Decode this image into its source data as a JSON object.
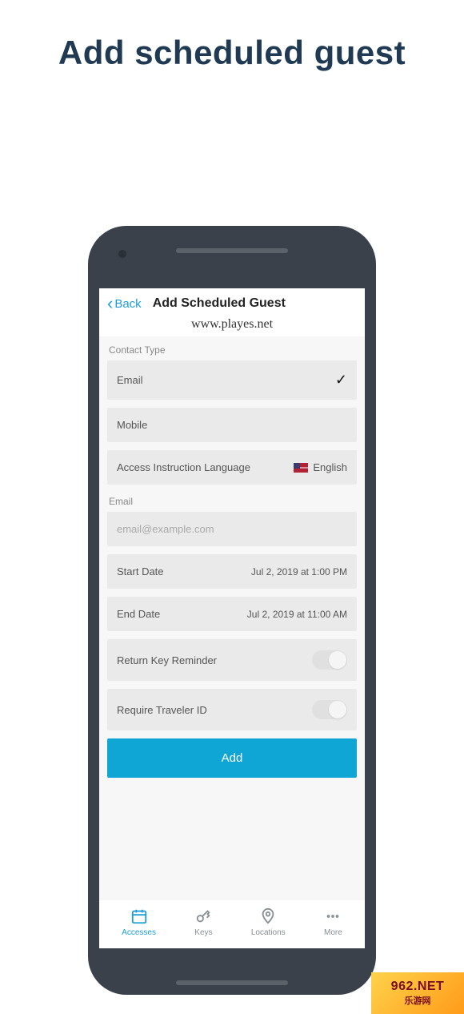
{
  "hero": {
    "title": "Add scheduled guest"
  },
  "watermark": "www.playes.net",
  "nav": {
    "back": "Back",
    "title": "Add Scheduled Guest"
  },
  "form": {
    "contact_type_label": "Contact Type",
    "email_option": "Email",
    "mobile_option": "Mobile",
    "language_label": "Access Instruction Language",
    "language_value": "English",
    "email_section_label": "Email",
    "email_placeholder": "email@example.com",
    "start_date_label": "Start Date",
    "start_date_value": "Jul 2, 2019 at 1:00 PM",
    "end_date_label": "End Date",
    "end_date_value": "Jul 2, 2019 at 11:00 AM",
    "return_key_label": "Return Key Reminder",
    "traveler_id_label": "Require Traveler ID",
    "add_button": "Add"
  },
  "tabs": {
    "accesses": "Accesses",
    "keys": "Keys",
    "locations": "Locations",
    "more": "More"
  },
  "brand": {
    "top": "962.NET",
    "bottom": "乐游网"
  }
}
